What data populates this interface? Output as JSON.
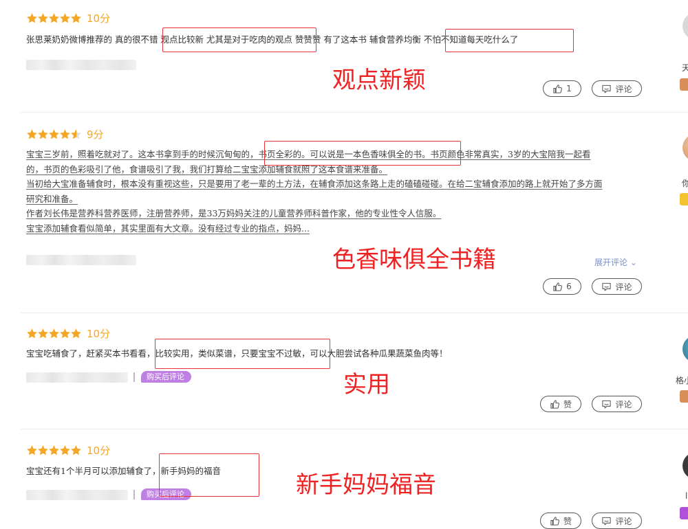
{
  "reviews": [
    {
      "score": "10分",
      "stars": 5,
      "lines": [
        "张思莱奶奶微博推荐的 真的很不错 观点比较新 尤其是对于吃肉的观点 赞赞赞 有了这本书 辅食营养均衡 不怕不知道每天吃什么了"
      ],
      "like": "1",
      "comment": "评论",
      "annotation": "观点新颖",
      "side_text": "天"
    },
    {
      "score": "9分",
      "stars": 4.5,
      "lines": [
        "宝宝三岁前，照着吃就对了。这本书拿到手的时候沉甸甸的，书页全彩的。可以说是一本色香味俱全的书。书页颜色非常真实，3岁的大宝陪我一起看",
        "的，书页的色彩吸引了他，食谱吸引了我，我们打算给二宝宝添加辅食就照了这本食谱来准备。",
        "当初给大宝准备辅食时，根本没有重视这些，只是要用了老一辈的土方法，在辅食添加这条路上走的磕磕碰碰。在给二宝辅食添加的路上就开始了多方面",
        "研究和准备。",
        "作者刘长伟是营养科营养医师，注册营养师，是33万妈妈关注的儿童营养师科普作家，他的专业性令人信服。",
        "宝宝添加辅食看似简单，其实里面有大文章。没有经过专业的指点，妈妈..."
      ],
      "expand": "展开评论 ⌄",
      "like": "6",
      "comment": "评论",
      "annotation": "色香味俱全书籍",
      "side_text": "你"
    },
    {
      "score": "10分",
      "stars": 5,
      "lines": [
        "宝宝吃辅食了，赶紧买本书看看，比较实用，类似菜谱，只要宝宝不过敏，可以大胆尝试各种瓜果蔬菜鱼肉等！"
      ],
      "badge": "购买后评论",
      "like": "赞",
      "comment": "评论",
      "annotation": "实用",
      "side_text": "格小"
    },
    {
      "score": "10分",
      "stars": 5,
      "lines": [
        "宝宝还有1个半月可以添加辅食了，新手妈妈的福音"
      ],
      "badge": "购买后评论",
      "like": "赞",
      "comment": "评论",
      "annotation": "新手妈妈福音",
      "side_text": "l"
    }
  ],
  "colors": {
    "star": "#f5a623",
    "highlight": "#e8323a",
    "annotation": "#ee2222",
    "badge": "#c07fe3",
    "link": "#7a8fc9"
  },
  "icons": [
    "star-icon",
    "thumbs-up-icon",
    "comment-icon"
  ]
}
